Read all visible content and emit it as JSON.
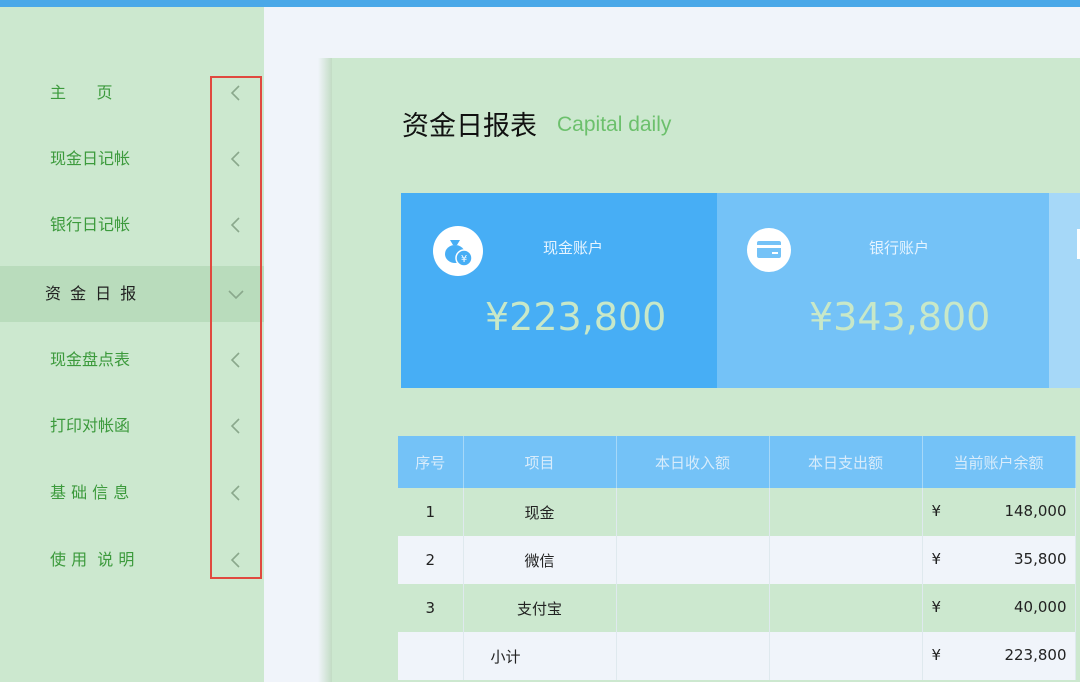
{
  "sidebar": {
    "items": [
      {
        "label": "主      页",
        "active": false
      },
      {
        "label": "现金日记帐",
        "active": false
      },
      {
        "label": "银行日记帐",
        "active": false
      },
      {
        "label": "资 金 日 报",
        "active": true
      },
      {
        "label": "现金盘点表",
        "active": false
      },
      {
        "label": "打印对帐函",
        "active": false
      },
      {
        "label": "基 础 信 息",
        "active": false
      },
      {
        "label": "使 用  说 明",
        "active": false
      }
    ]
  },
  "main": {
    "title": "资金日报表",
    "subtitle": "Capital daily",
    "cards": [
      {
        "label": "现金账户",
        "value": "¥223,800",
        "icon": "money-bag-icon",
        "color": "#47aef5"
      },
      {
        "label": "银行账户",
        "value": "¥343,800",
        "icon": "credit-card-icon",
        "color": "#74c2f7"
      }
    ],
    "table": {
      "headers": [
        "序号",
        "项目",
        "本日收入额",
        "本日支出额",
        "当前账户余额"
      ],
      "rows": [
        {
          "no": "1",
          "item": "现金",
          "income": "",
          "expense": "",
          "currency": "¥",
          "balance": "148,000"
        },
        {
          "no": "2",
          "item": "微信",
          "income": "",
          "expense": "",
          "currency": "¥",
          "balance": "35,800"
        },
        {
          "no": "3",
          "item": "支付宝",
          "income": "",
          "expense": "",
          "currency": "¥",
          "balance": "40,000"
        },
        {
          "no": "",
          "item": "小计",
          "income": "",
          "expense": "",
          "currency": "¥",
          "balance": "223,800"
        }
      ]
    }
  },
  "colors": {
    "sidebar_bg": "#cce8cf",
    "accent_green": "#3c9a3c",
    "card_blue": "#47aef5",
    "card_light_blue": "#74c2f7",
    "highlight_box": "#e0493f",
    "top_bar": "#4aa8e8"
  }
}
